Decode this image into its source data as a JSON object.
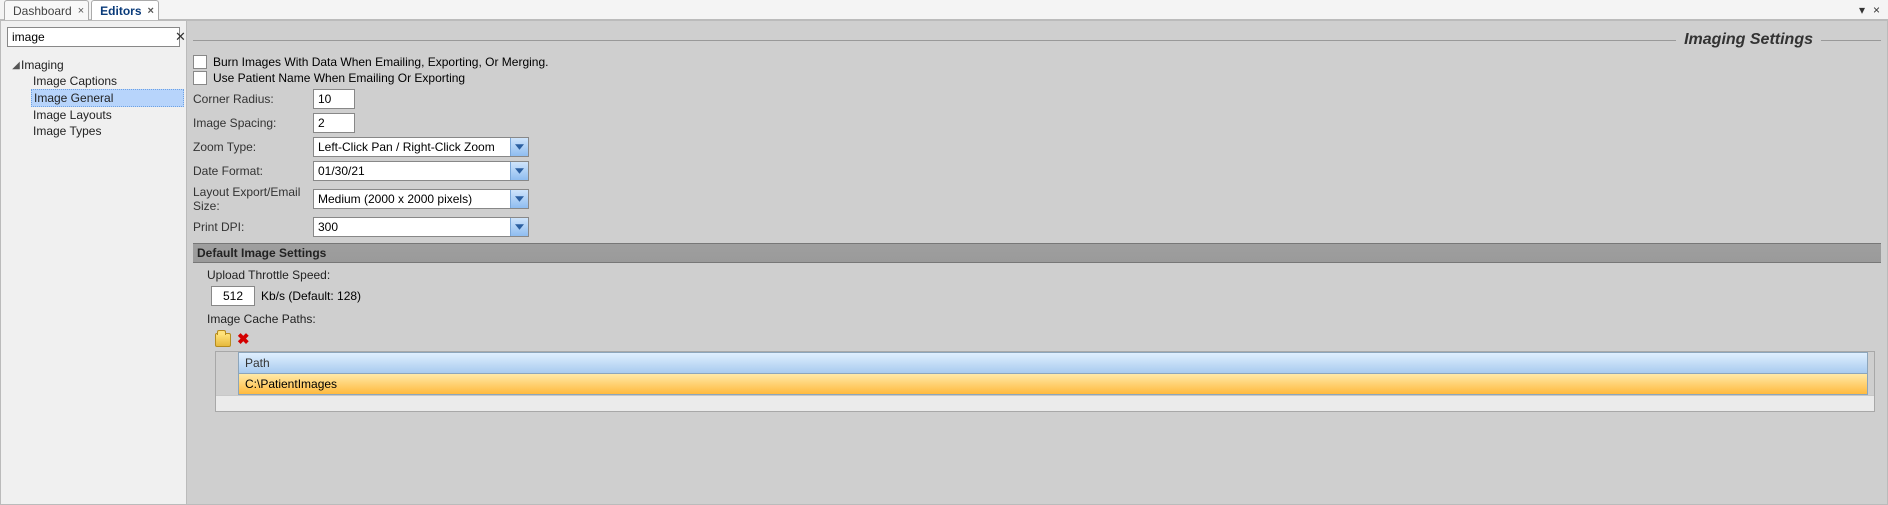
{
  "tabs": [
    {
      "label": "Dashboard",
      "active": false
    },
    {
      "label": "Editors",
      "active": true
    }
  ],
  "search": {
    "value": "image"
  },
  "tree": {
    "root": "Imaging",
    "children": [
      "Image Captions",
      "Image General",
      "Image Layouts",
      "Image Types"
    ],
    "selected": "Image General"
  },
  "header": {
    "title": "Imaging Settings"
  },
  "checks": {
    "burn": "Burn Images With Data When Emailing, Exporting, Or Merging.",
    "patient_name": "Use Patient Name When Emailing Or Exporting"
  },
  "fields": {
    "corner_radius": {
      "label": "Corner Radius:",
      "value": "10"
    },
    "image_spacing": {
      "label": "Image Spacing:",
      "value": "2"
    },
    "zoom_type": {
      "label": "Zoom Type:",
      "value": "Left-Click Pan / Right-Click Zoom"
    },
    "date_format": {
      "label": "Date Format:",
      "value": "01/30/21"
    },
    "layout_size": {
      "label": "Layout Export/Email Size:",
      "value": "Medium (2000 x 2000 pixels)"
    },
    "print_dpi": {
      "label": "Print DPI:",
      "value": "300"
    }
  },
  "section": {
    "title": "Default Image Settings"
  },
  "upload": {
    "label": "Upload Throttle Speed:",
    "value": "512",
    "unit_text": "Kb/s (Default: 128)"
  },
  "cache": {
    "label": "Image Cache Paths:",
    "header": "Path",
    "rows": [
      "C:\\PatientImages"
    ]
  }
}
